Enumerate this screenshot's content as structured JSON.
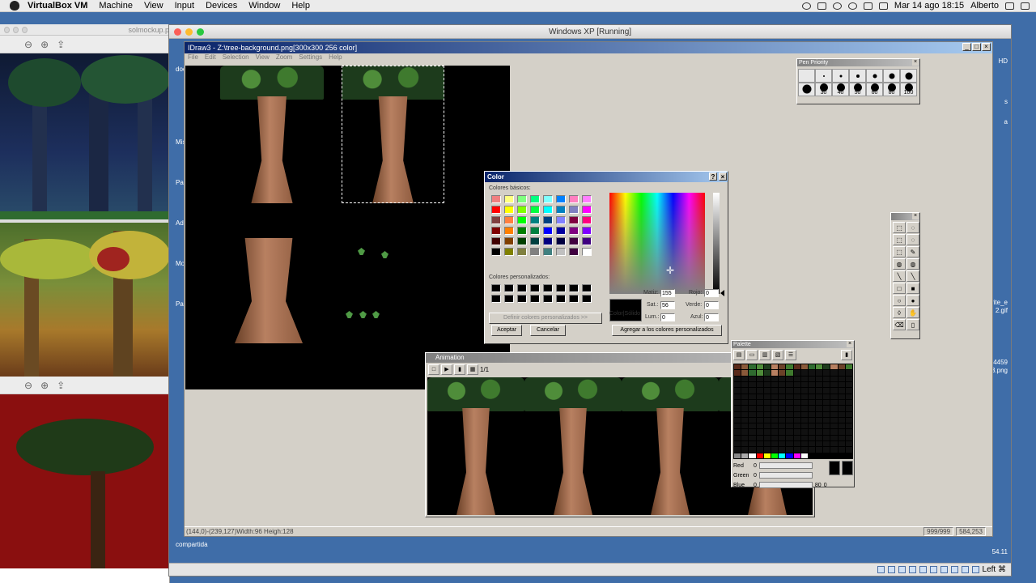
{
  "menubar": {
    "app": "VirtualBox VM",
    "items": [
      "Machine",
      "View",
      "Input",
      "Devices",
      "Window",
      "Help"
    ],
    "clock": "Mar 14 ago  18:15",
    "user": "Alberto"
  },
  "leftwin": {
    "title": "solmockup.p"
  },
  "vbox": {
    "title": "Windows XP [Running]",
    "host_key": "Left ⌘"
  },
  "desktop": {
    "left_labels": [
      "doc",
      "Mis",
      "Pa",
      "Ado",
      "Moz",
      "Pai"
    ],
    "right_labels": [
      "HD",
      "s",
      "a",
      "rite_e",
      "2.gif",
      "4459",
      "3.png",
      "54.11"
    ],
    "shared": "compartida"
  },
  "idraw": {
    "title": "IDraw3 - Z:\\tree-background.png[300x300 256 color]",
    "menu": [
      "File",
      "Edit",
      "Selection",
      "View",
      "Zoom",
      "Settings",
      "Help"
    ],
    "status_left": "(144,0)-(239,127)Width:96 Heigh:128",
    "status_r1": "999/999",
    "status_r2": "584,253"
  },
  "penpriority": {
    "title": "Pen Priority",
    "sizes": [
      "30",
      "40",
      "50",
      "60",
      "80",
      "100"
    ]
  },
  "colordialog": {
    "title": "Color",
    "help": "?",
    "close": "×",
    "basic_label": "Colores básicos:",
    "custom_label": "Colores personalizados:",
    "define_btn": "Definir colores personalizados >>",
    "ok": "Aceptar",
    "cancel": "Cancelar",
    "add_btn": "Agregar a los colores personalizados",
    "solid": "Color|Sólido",
    "hue_label": "Matiz:",
    "hue": "155",
    "sat_label": "Sat.:",
    "sat": "56",
    "lum_label": "Lum.:",
    "lum": "0",
    "red_label": "Rojo:",
    "red": "0",
    "green_label": "Verde:",
    "green": "0",
    "blue_label": "Azul:",
    "blue": "0",
    "basic": [
      "#f08080",
      "#ffff80",
      "#80ff80",
      "#00ff80",
      "#80ffff",
      "#0080ff",
      "#ff80c0",
      "#ff80ff",
      "#ff0000",
      "#ffff00",
      "#80ff00",
      "#00ff40",
      "#00ffff",
      "#0080c0",
      "#8080c0",
      "#ff00ff",
      "#804040",
      "#ff8040",
      "#00ff00",
      "#008080",
      "#004080",
      "#8080ff",
      "#800040",
      "#ff0080",
      "#800000",
      "#ff8000",
      "#008000",
      "#008040",
      "#0000ff",
      "#0000a0",
      "#800080",
      "#8000ff",
      "#400000",
      "#804000",
      "#004000",
      "#004040",
      "#000080",
      "#000040",
      "#400040",
      "#400080",
      "#000000",
      "#808000",
      "#808040",
      "#808080",
      "#408080",
      "#c0c0c0",
      "#400040",
      "#ffffff"
    ]
  },
  "animation": {
    "title": "Animation",
    "frame": "1/1"
  },
  "palette": {
    "title": "Palette",
    "red_label": "Red",
    "red": "0",
    "green_label": "Green",
    "green": "0",
    "blue_label": "Blue",
    "blue": "0",
    "val1": "80",
    "val2": "0"
  }
}
